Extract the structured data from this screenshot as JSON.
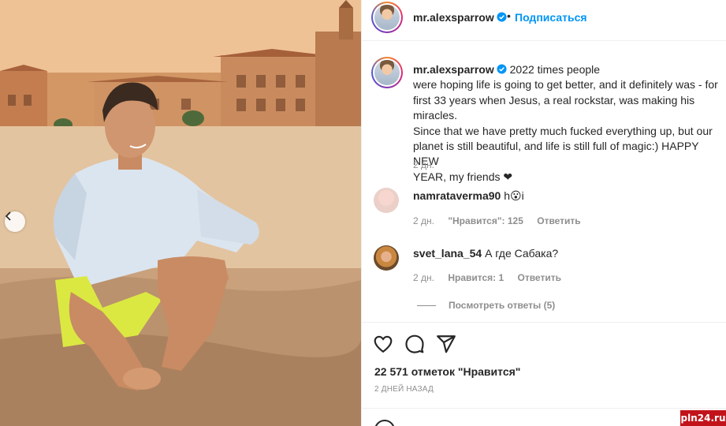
{
  "post": {
    "username": "mr.alexsparrow",
    "follow_label": "Подписаться",
    "dot": "•",
    "caption_first": "2022 times people",
    "caption_body": "were hoping life is going to get better, and it definitely was - for\nfirst 33 years when Jesus, a real rockstar, was making his miracles.\nSince that we have pretty much fucked everything up, but our\nplanet is still beautiful, and life is still full of magic:) HAPPY NEW\nYEAR, my friends ❤",
    "caption_time": "2 дн.",
    "likes": "22 571 отметок \"Нравится\"",
    "date": "2 ДНЕЙ НАЗАД"
  },
  "comments": [
    {
      "username": "namrataverma90",
      "text": "h😮i",
      "time": "2 дн.",
      "likes": "\"Нравится\": 125",
      "reply_label": "Ответить"
    },
    {
      "username": "svet_lana_54",
      "text": "А где Сабака?",
      "time": "2 дн.",
      "likes": "Нравится: 1",
      "reply_label": "Ответить",
      "view_replies": "Посмотреть ответы (5)"
    }
  ],
  "icons": [
    "verified-badge-icon",
    "heart-icon",
    "comment-icon",
    "share-icon",
    "chevron-left-icon",
    "emoji-icon"
  ],
  "colors": {
    "accent": "#0095f6",
    "text": "#262626",
    "muted": "#8e8e8e",
    "divider": "#efefef",
    "watermark": "#c2131b"
  },
  "watermark": "pln24.ru"
}
